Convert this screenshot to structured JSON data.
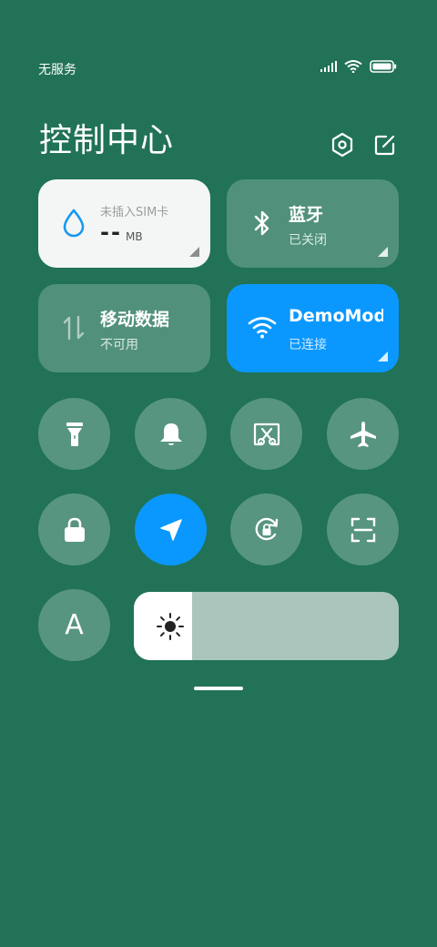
{
  "status_bar": {
    "carrier": "无服务",
    "icons": [
      "signal-icon",
      "wifi-icon",
      "battery-icon"
    ]
  },
  "header": {
    "title": "控制中心",
    "settings_icon": "hexagon-settings-icon",
    "edit_icon": "edit-icon"
  },
  "tiles": {
    "data_usage": {
      "label": "未插入SIM卡",
      "value": "--",
      "unit": "MB",
      "icon": "water-drop-icon"
    },
    "bluetooth": {
      "title": "蓝牙",
      "status": "已关闭",
      "icon": "bluetooth-icon"
    },
    "mobile_data": {
      "title": "移动数据",
      "status": "不可用",
      "icon": "data-arrows-icon"
    },
    "wifi": {
      "title": "DemoMode",
      "status": "已连接",
      "icon": "wifi-icon"
    }
  },
  "toggles": [
    {
      "name": "flashlight",
      "icon": "flashlight-icon",
      "active": false
    },
    {
      "name": "mute",
      "icon": "bell-icon",
      "active": false
    },
    {
      "name": "screenshot",
      "icon": "scissors-icon",
      "active": false
    },
    {
      "name": "airplane",
      "icon": "airplane-icon",
      "active": false
    },
    {
      "name": "lock",
      "icon": "lock-icon",
      "active": false
    },
    {
      "name": "location",
      "icon": "location-arrow-icon",
      "active": true
    },
    {
      "name": "rotation-lock",
      "icon": "rotation-lock-icon",
      "active": false
    },
    {
      "name": "scan",
      "icon": "scan-icon",
      "active": false
    }
  ],
  "auto_brightness": {
    "label": "A"
  },
  "brightness": {
    "level": 0.22,
    "icon": "sun-icon"
  },
  "colors": {
    "background": "#217257",
    "accent": "#0a98ff",
    "tile_light": "#f4f6f5"
  }
}
